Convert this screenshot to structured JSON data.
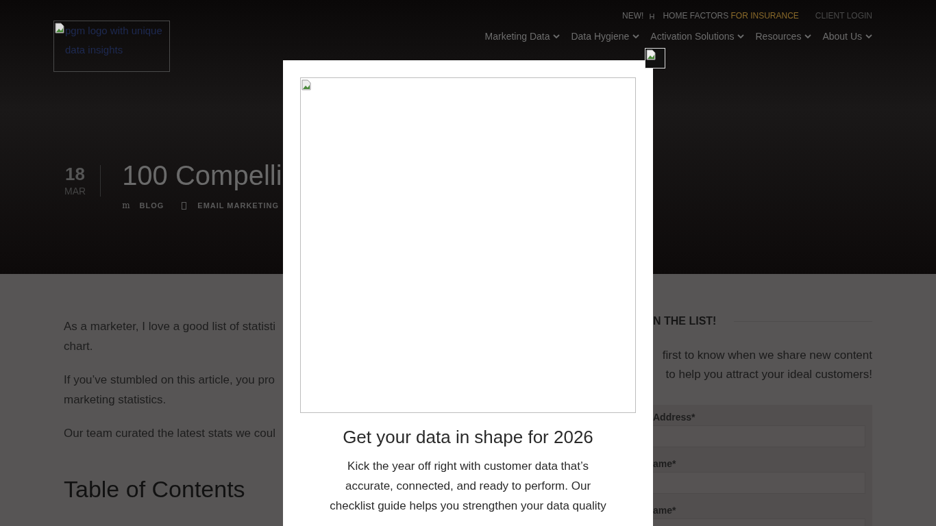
{
  "logo": {
    "alt_text": "pgm logo with unique data insights"
  },
  "top_bar": {
    "badge": "NEW!",
    "glyph": "H",
    "promo": "HOME FACTORS",
    "promo_highlight": "FOR INSURANCE",
    "login": "CLIENT LOGIN"
  },
  "nav": [
    {
      "label": "Marketing Data"
    },
    {
      "label": "Data Hygiene"
    },
    {
      "label": "Activation Solutions"
    },
    {
      "label": "Resources"
    },
    {
      "label": "About Us"
    }
  ],
  "post": {
    "day": "18",
    "month": "MAR",
    "title": "100 Compelli",
    "meta": [
      {
        "kind": "glyph",
        "glyph": "m",
        "label": "BLOG"
      },
      {
        "kind": "box",
        "label": "EMAIL MARKETING"
      }
    ]
  },
  "article": {
    "paragraphs": [
      [
        "As a marketer, I love a good list of statisti",
        "chart."
      ],
      [
        "If you’ve stumbled on this article, you pro",
        "marketing statistics."
      ],
      [
        "Our team curated the latest stats we coul"
      ]
    ],
    "toc_heading": "Table of Contents"
  },
  "sidebar": {
    "heading": "N THE LIST!",
    "text": [
      "first to know when we share new content",
      "to help you attract your ideal customers!"
    ],
    "fields": [
      {
        "label": "Address*"
      },
      {
        "label": "ame*"
      },
      {
        "label": "ame*"
      }
    ]
  },
  "modal": {
    "heading": "Get your data in shape for 2026",
    "body": "Kick the year off right with customer data that’s accurate, connected, and ready to perform. Our checklist guide helps you strengthen your data quality"
  }
}
